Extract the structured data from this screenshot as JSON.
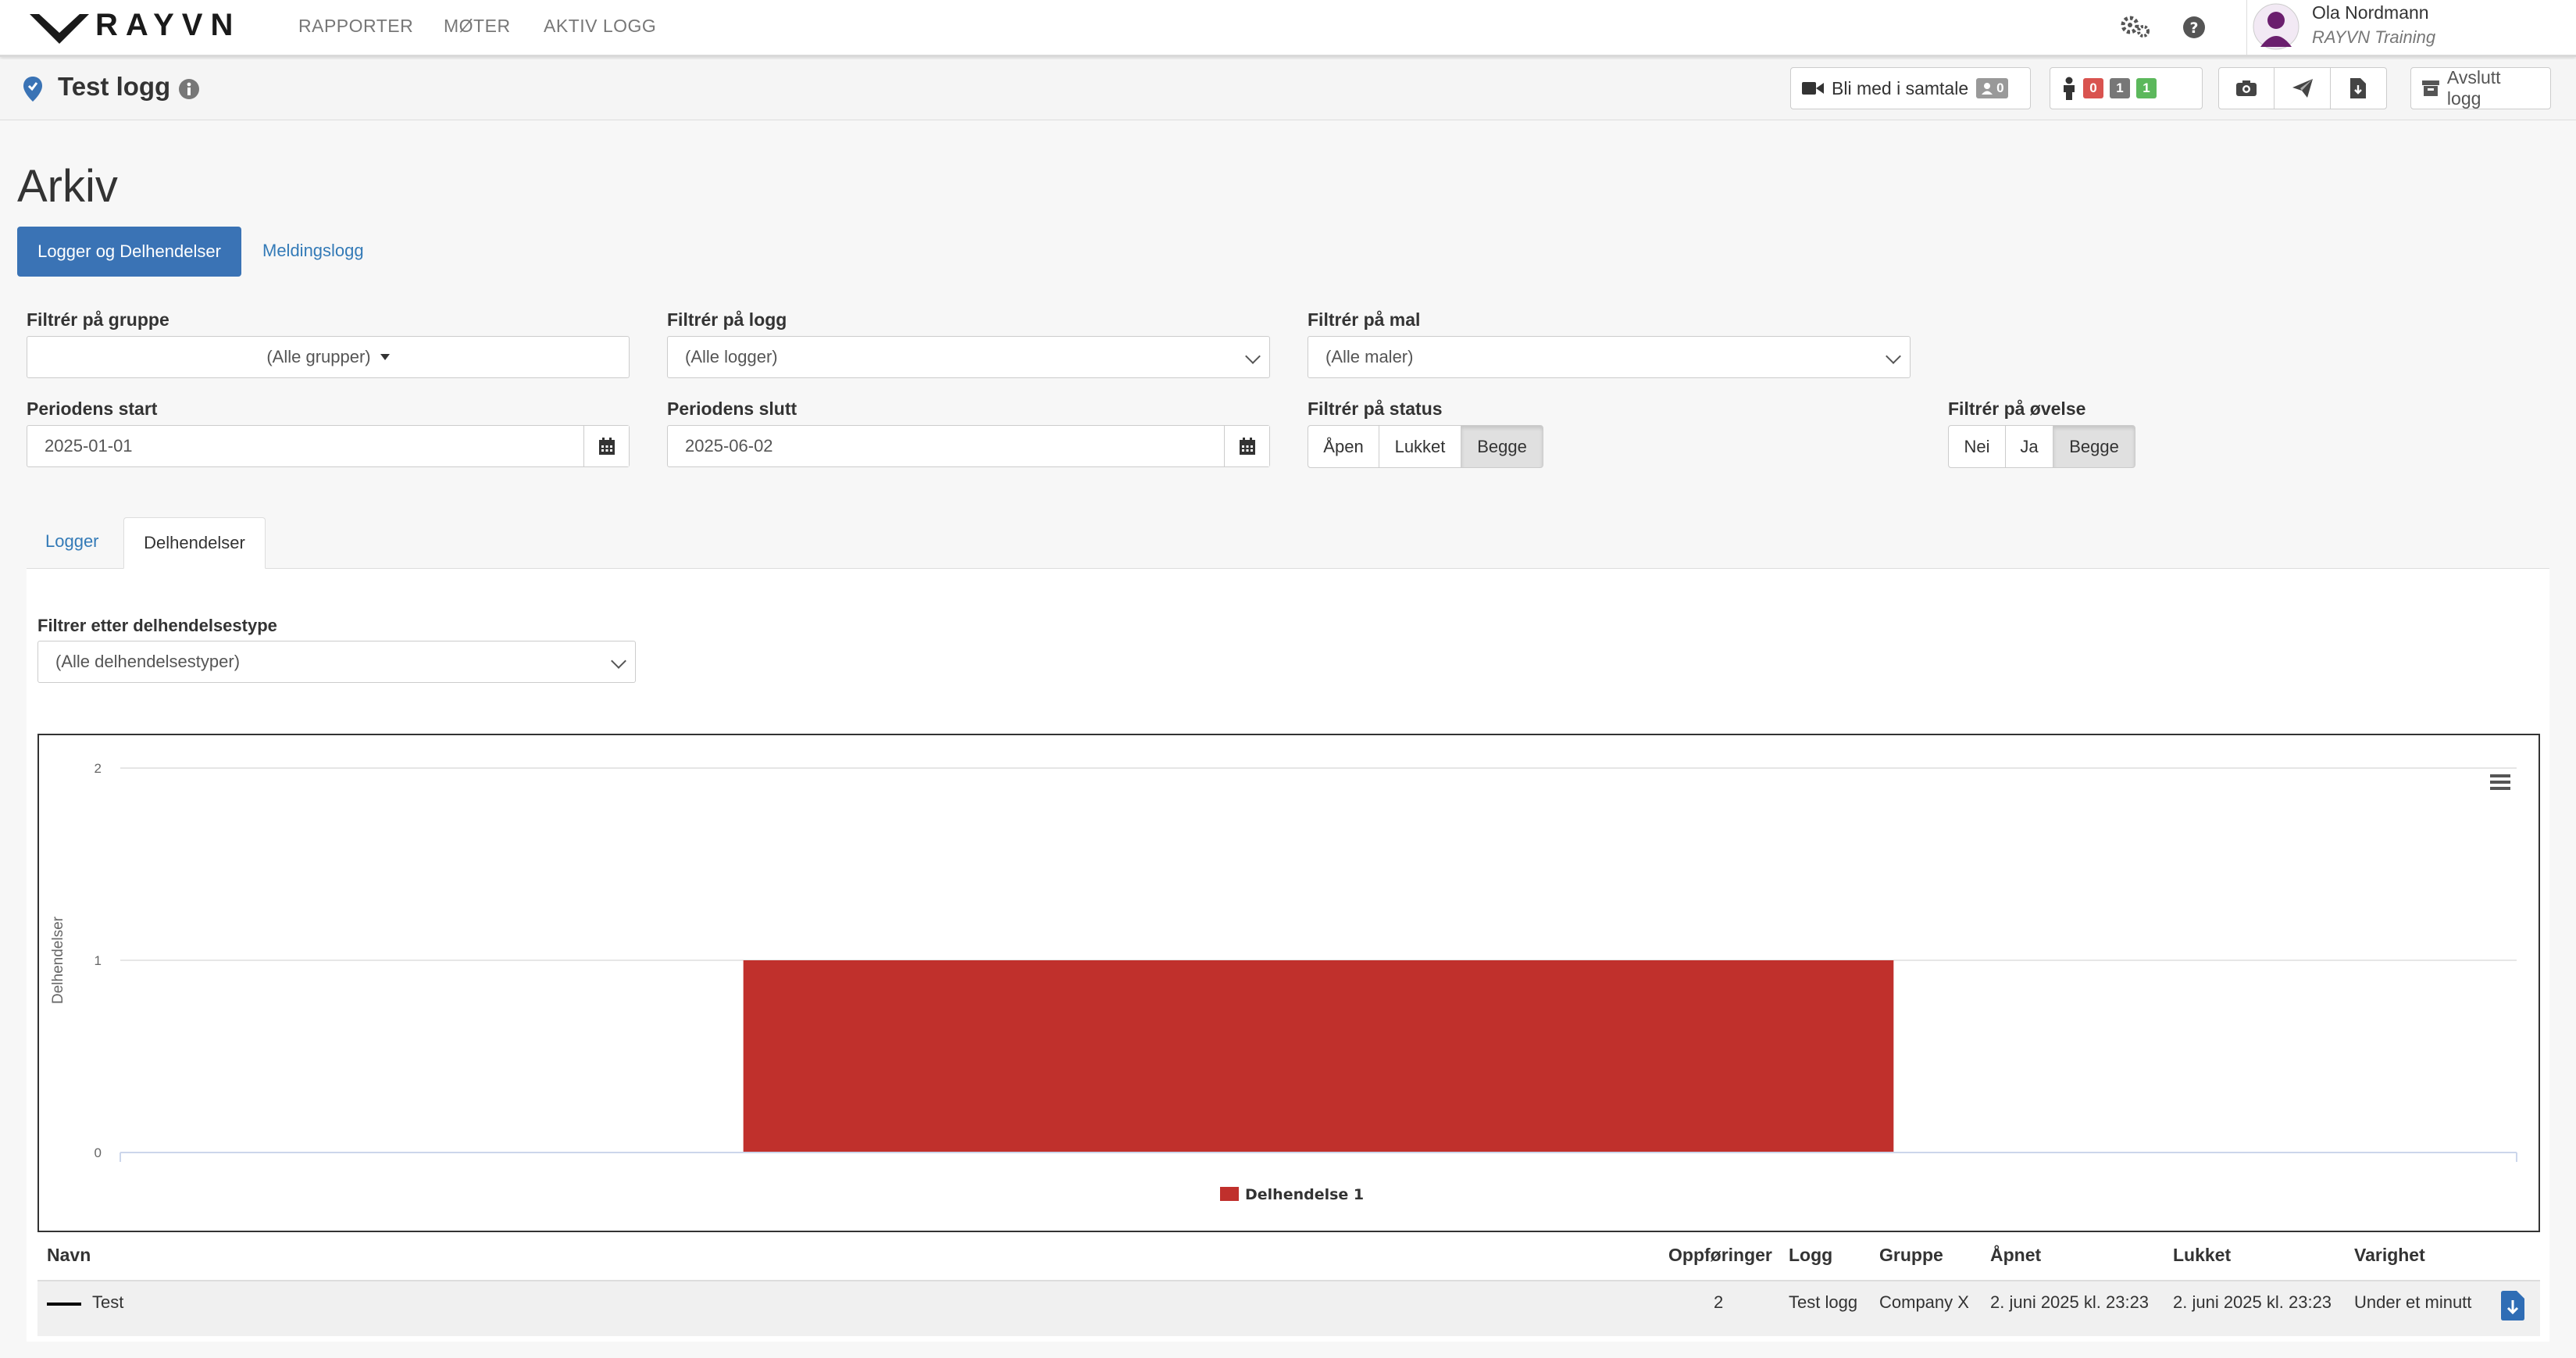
{
  "brand": {
    "name": "RAYVN"
  },
  "nav": {
    "items": [
      "RAPPORTER",
      "MØTER",
      "AKTIV LOGG"
    ]
  },
  "user": {
    "name": "Ola Nordmann",
    "org": "RAYVN Training"
  },
  "log_header": {
    "title": "Test logg",
    "join_call_label": "Bli med i samtale",
    "call_participants": "0",
    "person_counts": [
      "0",
      "1",
      "1"
    ],
    "close_label": "Avslutt logg"
  },
  "page": {
    "title": "Arkiv",
    "pills": [
      "Logger og Delhendelser",
      "Meldingslogg"
    ]
  },
  "filters": {
    "group_label": "Filtrér på gruppe",
    "group_value": "(Alle grupper)",
    "log_label": "Filtrér på logg",
    "log_value": "(Alle logger)",
    "template_label": "Filtrér på mal",
    "template_value": "(Alle maler)",
    "start_label": "Periodens start",
    "start_value": "2025-01-01",
    "end_label": "Periodens slutt",
    "end_value": "2025-06-02",
    "status_label": "Filtrér på status",
    "status_options": [
      "Åpen",
      "Lukket",
      "Begge"
    ],
    "exercise_label": "Filtrér på øvelse",
    "exercise_options": [
      "Nei",
      "Ja",
      "Begge"
    ]
  },
  "tabs": [
    "Logger",
    "Delhendelser"
  ],
  "subevent_filter": {
    "label": "Filtrer etter delhendelsestype",
    "value": "(Alle delhendelsestyper)"
  },
  "colors": {
    "primary": "#3a73b5",
    "bar": "#c0302c",
    "badge_red": "#d9534f",
    "badge_gray": "#777777",
    "badge_green": "#5cb85c"
  },
  "chart_data": {
    "type": "bar",
    "categories": [
      ""
    ],
    "series": [
      {
        "name": "Delhendelse 1",
        "values": [
          1
        ]
      }
    ],
    "title": "",
    "xlabel": "",
    "ylabel": "Delhendelser",
    "ylim": [
      0,
      2
    ],
    "yticks": [
      "0",
      "1",
      "2"
    ],
    "grid": true,
    "legend": "bottom-center"
  },
  "table": {
    "headers": [
      "Navn",
      "Oppføringer",
      "Logg",
      "Gruppe",
      "Åpnet",
      "Lukket",
      "Varighet"
    ],
    "rows": [
      [
        "Test",
        "2",
        "Test logg",
        "Company X",
        "2. juni 2025 kl. 23:23",
        "2. juni 2025 kl. 23:23",
        "Under et minutt"
      ]
    ]
  }
}
